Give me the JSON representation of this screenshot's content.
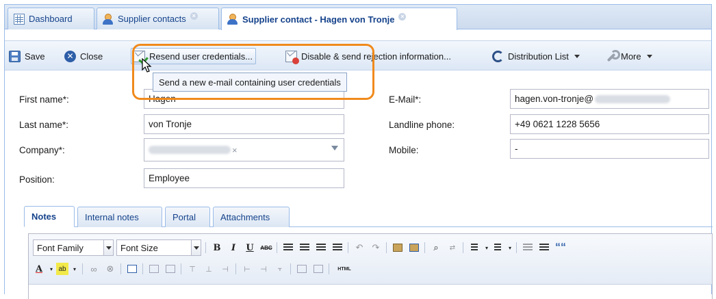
{
  "tabs": [
    {
      "label": "Dashboard",
      "icon": "dashboard-icon",
      "closable": false
    },
    {
      "label": "Supplier contacts",
      "icon": "users-icon",
      "closable": true
    },
    {
      "label": "Supplier contact - Hagen von Tronje",
      "icon": "users-icon",
      "closable": true,
      "active": true
    }
  ],
  "toolbar": {
    "save": "Save",
    "close": "Close",
    "resend": "Resend user credentials...",
    "disable": "Disable & send rejection information...",
    "distribution": "Distribution List",
    "more": "More"
  },
  "tooltip": "Send a new e-mail containing user credentials",
  "form": {
    "first_name_label": "First name*:",
    "first_name_value": "Hagen",
    "last_name_label": "Last name*:",
    "last_name_value": "von Tronje",
    "company_label": "Company*:",
    "position_label": "Position:",
    "position_value": "Employee",
    "email_label": "E-Mail*:",
    "email_value": "hagen.von-tronje@",
    "landline_label": "Landline phone:",
    "landline_value": "+49 0621 1228 5656",
    "mobile_label": "Mobile:",
    "mobile_value": "-"
  },
  "inner_tabs": [
    "Notes",
    "Internal notes",
    "Portal",
    "Attachments"
  ],
  "editor": {
    "font_family": "Font Family",
    "font_size": "Font Size",
    "bold": "B",
    "italic": "I",
    "underline": "U",
    "strike": "ABC",
    "quote": "““",
    "html": "HTML"
  },
  "colors": {
    "accent": "#15428b",
    "highlight": "#f08a1c",
    "border": "#99bbe8"
  }
}
